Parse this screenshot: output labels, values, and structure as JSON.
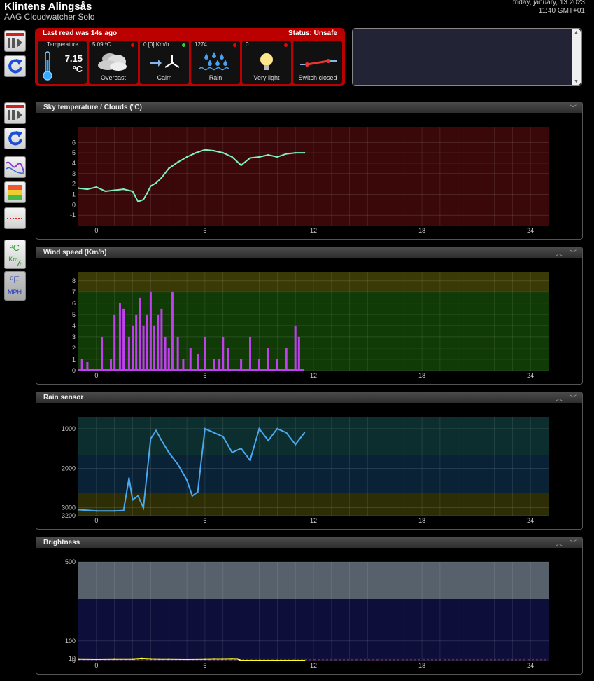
{
  "site": {
    "title": "Klintens Alingsås",
    "subtitle": "AAG Cloudwatcher Solo"
  },
  "datetime": {
    "date": "friday, january, 13 2023",
    "time": "11:40 GMT+01"
  },
  "status": {
    "last_read": "Last read was 14s ago",
    "status": "Status: Unsafe",
    "tiles": [
      {
        "key": "temperature",
        "label": "Temperature",
        "value": "7.15",
        "unit": "ºC",
        "caption": ""
      },
      {
        "key": "clouds",
        "value": "5.09 ºC",
        "caption": "Overcast",
        "dot": "#e00"
      },
      {
        "key": "wind",
        "value": "0 [0] Km/h",
        "caption": "Calm",
        "dot": "#3c3"
      },
      {
        "key": "rain",
        "value": "1274",
        "caption": "Rain",
        "dot": "#e00"
      },
      {
        "key": "light",
        "value": "0",
        "caption": "Very light",
        "dot": "#e00"
      },
      {
        "key": "switch",
        "value": "",
        "caption": "Switch closed"
      }
    ]
  },
  "toolbar_icons": [
    "pause-icon",
    "refresh-icon",
    "pause-icon",
    "refresh-icon",
    "chart-line-icon",
    "color-scale-icon",
    "dotted-line-icon",
    "celsius-kmh-icon",
    "fahrenheit-mph-icon"
  ],
  "toolbar_labels": {
    "celsius": "ºC",
    "kmh_km": "Km",
    "kmh_h": "h",
    "fahrenheit": "ºF",
    "mph": "MPH"
  },
  "colors": {
    "status_bg": "#bb0000",
    "sky_series": "#7ff0c0",
    "wind_series": "#c040f0",
    "rain_series": "#4aa8f0",
    "bright_series": "#ffff20"
  },
  "x_ticks": [
    "0",
    "6",
    "12",
    "18",
    "24"
  ],
  "panels": {
    "sky": {
      "title": "Sky temperature / Clouds (ºC)"
    },
    "wind": {
      "title": "Wind speed (Km/h)"
    },
    "rain": {
      "title": "Rain sensor"
    },
    "bright": {
      "title": "Brightness"
    }
  },
  "chart_data": [
    {
      "type": "line",
      "title": "Sky temperature / Clouds (ºC)",
      "xlim": [
        -1,
        25
      ],
      "ylim": [
        -2,
        7.5
      ],
      "yticks": [
        "-1",
        "0",
        "1",
        "2",
        "3",
        "4",
        "5",
        "6"
      ],
      "ytick_values": [
        -1,
        0,
        1,
        2,
        3,
        4,
        5,
        6
      ],
      "x": [
        -1,
        -0.5,
        0,
        0.5,
        1,
        1.5,
        2,
        2.3,
        2.6,
        2.8,
        3,
        3.3,
        3.6,
        4,
        4.5,
        5,
        5.5,
        6,
        6.5,
        7,
        7.5,
        8,
        8.5,
        9,
        9.5,
        10,
        10.5,
        11,
        11.5
      ],
      "series": [
        {
          "values": [
            1.6,
            1.5,
            1.7,
            1.3,
            1.4,
            1.5,
            1.3,
            0.3,
            0.5,
            1.1,
            1.8,
            2.1,
            2.6,
            3.5,
            4.1,
            4.6,
            5.0,
            5.3,
            5.2,
            5.0,
            4.6,
            3.8,
            4.5,
            4.6,
            4.8,
            4.6,
            4.9,
            5.0,
            5.0
          ]
        }
      ]
    },
    {
      "type": "bar",
      "title": "Wind speed (Km/h)",
      "xlim": [
        -1,
        25
      ],
      "ylim": [
        0,
        8.8
      ],
      "yticks": [
        "0",
        "1",
        "2",
        "3",
        "4",
        "5",
        "6",
        "7",
        "8"
      ],
      "ytick_values": [
        0,
        1,
        2,
        3,
        4,
        5,
        6,
        7,
        8
      ],
      "x": [
        -0.8,
        -0.5,
        0.3,
        0.8,
        1,
        1.3,
        1.5,
        1.8,
        2,
        2.2,
        2.4,
        2.6,
        2.8,
        3,
        3.2,
        3.4,
        3.6,
        3.8,
        4,
        4.2,
        4.5,
        4.8,
        5.2,
        5.6,
        6,
        6.5,
        6.8,
        7,
        7.3,
        8,
        8.5,
        9,
        9.5,
        10,
        10.5,
        11,
        11.2
      ],
      "series": [
        {
          "values": [
            1,
            0.8,
            3,
            1,
            5,
            6,
            5.5,
            3,
            4,
            5,
            6.5,
            4,
            5,
            7,
            4,
            5,
            5.5,
            3,
            2,
            7,
            3,
            1,
            2,
            1.5,
            3,
            1,
            1,
            3,
            2,
            1,
            3,
            1,
            2,
            1,
            2,
            4,
            3
          ]
        }
      ]
    },
    {
      "type": "line",
      "title": "Rain sensor",
      "xlim": [
        -1,
        25
      ],
      "ylim": [
        3200,
        700
      ],
      "yticks": [
        "1000",
        "2000",
        "3000",
        "3200"
      ],
      "ytick_values": [
        1000,
        2000,
        3000,
        3200
      ],
      "x": [
        -1,
        0,
        1,
        1.5,
        1.8,
        2,
        2.3,
        2.6,
        3,
        3.3,
        3.6,
        4,
        4.5,
        5,
        5.3,
        5.6,
        6,
        6.5,
        7,
        7.5,
        8,
        8.5,
        9,
        9.5,
        10,
        10.5,
        11,
        11.5
      ],
      "series": [
        {
          "values": [
            3050,
            3080,
            3080,
            3070,
            2250,
            2800,
            2700,
            3000,
            1250,
            1050,
            1300,
            1600,
            1900,
            2300,
            2700,
            2600,
            1000,
            1100,
            1200,
            1600,
            1500,
            1800,
            1000,
            1300,
            1000,
            1100,
            1400,
            1100
          ]
        }
      ]
    },
    {
      "type": "line",
      "title": "Brightness",
      "xlim": [
        -1,
        25
      ],
      "ylim": [
        0,
        500
      ],
      "yticks": [
        "0",
        "10",
        "100",
        "500"
      ],
      "ytick_values": [
        0,
        10,
        100,
        500
      ],
      "x": [
        -1,
        0,
        1,
        2,
        2.5,
        3,
        3.5,
        4,
        5,
        6,
        6.5,
        7,
        7.5,
        7.8,
        8,
        8.5,
        9,
        10,
        11,
        11.5
      ],
      "series": [
        {
          "values": [
            8,
            7,
            8,
            8,
            11,
            9,
            8,
            8,
            7,
            8,
            9,
            9,
            10,
            9,
            0.05,
            0.05,
            0.05,
            0.05,
            0.05,
            0.05
          ]
        }
      ]
    }
  ]
}
